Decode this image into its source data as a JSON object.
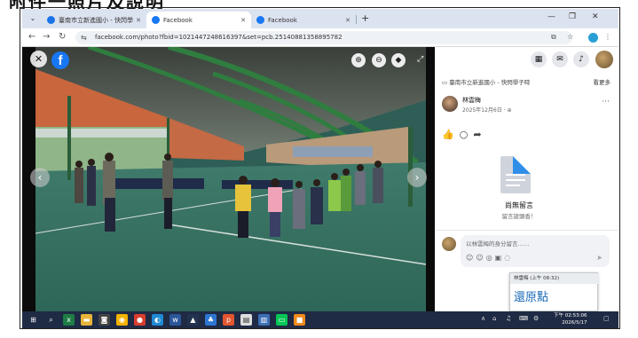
{
  "caption_top": "附件一照片及說明",
  "browser": {
    "tabs": [
      {
        "label": "臺南市立新進國小 - 快閃學子時",
        "favicon_color": "#1a73e8"
      },
      {
        "label": "Facebook",
        "favicon_color": "#1877f2"
      },
      {
        "label": "Facebook",
        "favicon_color": "#1877f2"
      }
    ],
    "new_tab": "+",
    "url": "facebook.com/photo?fbid=1021447248616397&set=pcb.2514088135889578​2"
  },
  "viewer": {
    "fb_logo": "f",
    "close_icon": "✕",
    "top_icons": [
      "⊕",
      "⊖",
      "◆"
    ]
  },
  "panel": {
    "page_row": "臺南市立新進國小 - 快閃學子時",
    "page_link": "看更多",
    "post_name": "林雲梅",
    "post_date": "2025年12月6日 · ⊕",
    "empty_title": "尚無留言",
    "empty_sub": "留言搶頭香！",
    "comment_placeholder": "以林雲梅的身分留言……"
  },
  "popup": {
    "header": "林雲梅 (上午 08:32)",
    "text": "還原點"
  },
  "taskbar": {
    "clock_time": "下午 02:53:06",
    "clock_date": "2026/5/17"
  },
  "colors": {
    "facebook_blue": "#1877f2",
    "taskbar": "#1f2a44"
  }
}
